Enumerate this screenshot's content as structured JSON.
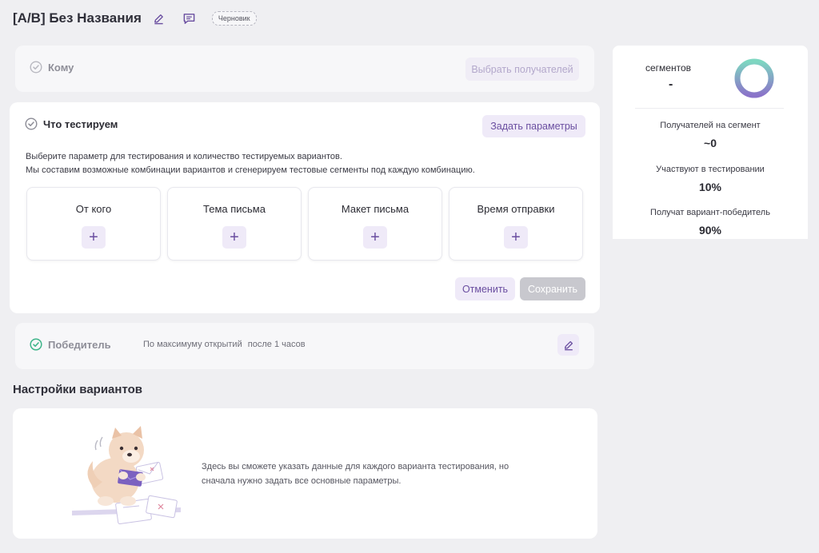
{
  "header": {
    "title": "[A/B] Без Названия",
    "status_badge": "Черновик"
  },
  "recipients": {
    "title": "Кому",
    "select_button": "Выбрать получателей"
  },
  "testing": {
    "title": "Что тестируем",
    "set_params_button": "Задать параметры",
    "description_line1": "Выберите параметр для тестирования и количество тестируемых вариантов.",
    "description_line2": "Мы составим возможные комбинации вариантов и сгенерируем тестовые сегменты под каждую комбинацию.",
    "options": [
      {
        "label": "От кого"
      },
      {
        "label": "Тема письма"
      },
      {
        "label": "Макет письма"
      },
      {
        "label": "Время отправки"
      }
    ],
    "plus_symbol": "+",
    "cancel_button": "Отменить",
    "save_button": "Сохранить"
  },
  "winner": {
    "title": "Победитель",
    "criterion": "По максимуму открытий",
    "delay": "после 1 часов"
  },
  "variants": {
    "section_title": "Настройки вариантов",
    "info_text": "Здесь вы сможете указать данные для каждого варианта тестирования, но сначала нужно задать все основные параметры."
  },
  "stats": {
    "segments_label": "сегментов",
    "segments_value": "-",
    "recipients_per_segment_label": "Получателей на сегмент",
    "recipients_per_segment_value": "~0",
    "participating_label": "Участвуют в тестировании",
    "participating_value": "10%",
    "winner_receive_label": "Получат вариант-победитель",
    "winner_receive_value": "90%"
  },
  "colors": {
    "accent": "#6a4ea0",
    "success": "#3fb58a",
    "donut_start": "#7ed7c1",
    "donut_end": "#8a73c9"
  }
}
